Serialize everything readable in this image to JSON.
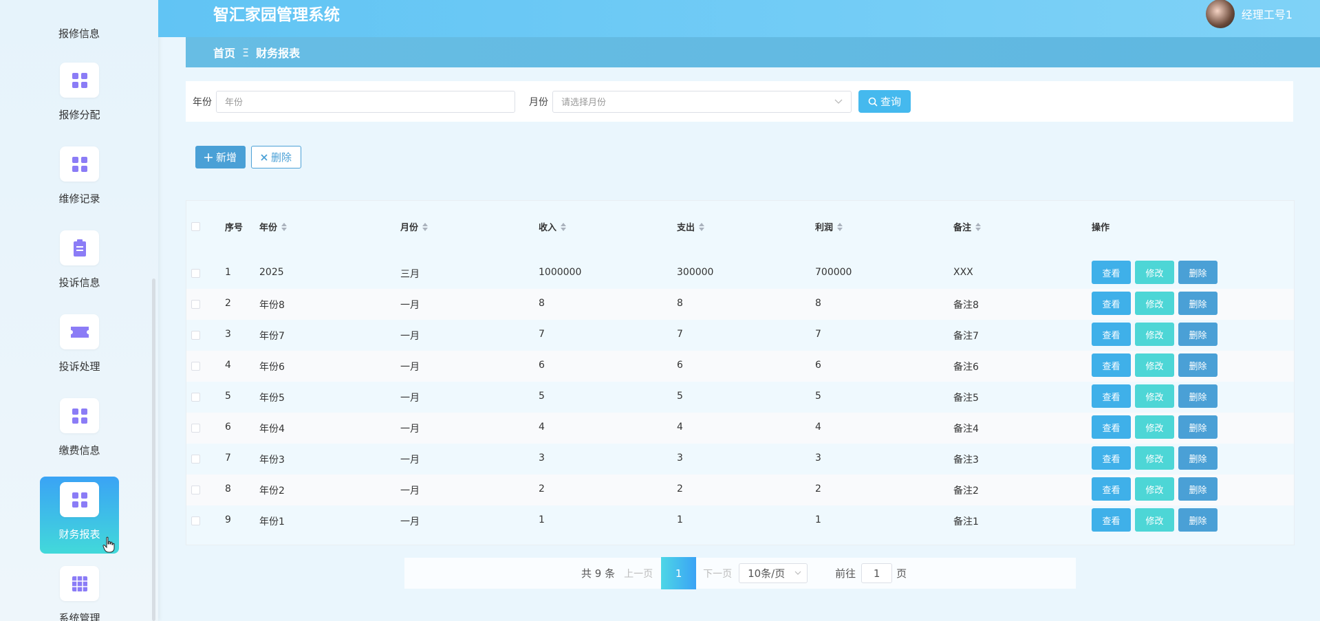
{
  "app": {
    "title": "智汇家园管理系统"
  },
  "user": {
    "name": "经理工号1"
  },
  "breadcrumb": {
    "home": "首页",
    "separator": "Ξ",
    "current": "财务报表"
  },
  "sidebar": {
    "items": [
      {
        "label": "报修信息",
        "icon": "grid-icon"
      },
      {
        "label": "报修分配",
        "icon": "grid-icon"
      },
      {
        "label": "维修记录",
        "icon": "grid-icon"
      },
      {
        "label": "投诉信息",
        "icon": "clipboard-icon"
      },
      {
        "label": "投诉处理",
        "icon": "ticket-icon"
      },
      {
        "label": "缴费信息",
        "icon": "grid-icon"
      },
      {
        "label": "财务报表",
        "icon": "grid-icon",
        "active": true
      },
      {
        "label": "系统管理",
        "icon": "table-grid-icon"
      }
    ]
  },
  "search": {
    "year_label": "年份",
    "year_placeholder": "年份",
    "month_label": "月份",
    "month_placeholder": "请选择月份",
    "query_label": "查询"
  },
  "actions": {
    "add_label": "新增",
    "delete_label": "删除"
  },
  "table": {
    "columns": [
      "序号",
      "年份",
      "月份",
      "收入",
      "支出",
      "利润",
      "备注",
      "操作"
    ],
    "row_actions": {
      "view": "查看",
      "edit": "修改",
      "delete": "删除"
    },
    "rows": [
      {
        "idx": "1",
        "year": "2025",
        "month": "三月",
        "income": "1000000",
        "expense": "300000",
        "profit": "700000",
        "note": "XXX"
      },
      {
        "idx": "2",
        "year": "年份8",
        "month": "一月",
        "income": "8",
        "expense": "8",
        "profit": "8",
        "note": "备注8"
      },
      {
        "idx": "3",
        "year": "年份7",
        "month": "一月",
        "income": "7",
        "expense": "7",
        "profit": "7",
        "note": "备注7"
      },
      {
        "idx": "4",
        "year": "年份6",
        "month": "一月",
        "income": "6",
        "expense": "6",
        "profit": "6",
        "note": "备注6"
      },
      {
        "idx": "5",
        "year": "年份5",
        "month": "一月",
        "income": "5",
        "expense": "5",
        "profit": "5",
        "note": "备注5"
      },
      {
        "idx": "6",
        "year": "年份4",
        "month": "一月",
        "income": "4",
        "expense": "4",
        "profit": "4",
        "note": "备注4"
      },
      {
        "idx": "7",
        "year": "年份3",
        "month": "一月",
        "income": "3",
        "expense": "3",
        "profit": "3",
        "note": "备注3"
      },
      {
        "idx": "8",
        "year": "年份2",
        "month": "一月",
        "income": "2",
        "expense": "2",
        "profit": "2",
        "note": "备注2"
      },
      {
        "idx": "9",
        "year": "年份1",
        "month": "一月",
        "income": "1",
        "expense": "1",
        "profit": "1",
        "note": "备注1"
      }
    ]
  },
  "pagination": {
    "total_text": "共 9 条",
    "prev_label": "上一页",
    "current_page": "1",
    "next_label": "下一页",
    "page_size": "10条/页",
    "goto_label": "前往",
    "goto_value": "1",
    "goto_unit": "页"
  },
  "colors": {
    "primary": "#45b9ee",
    "header": "#61c4f4",
    "edit": "#4dd6d6",
    "delete": "#4aa0d6"
  }
}
